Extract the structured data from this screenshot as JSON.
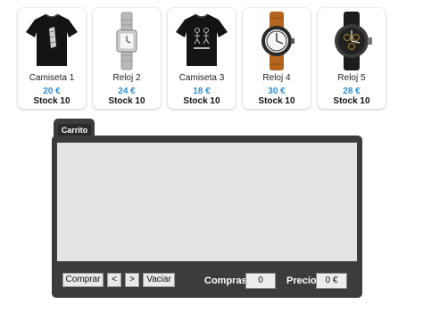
{
  "products": [
    {
      "name": "Camiseta 1",
      "price": "20 €",
      "stock": "Stock 10",
      "icon": "tshirt-icon"
    },
    {
      "name": "Reloj 2",
      "price": "24 €",
      "stock": "Stock 10",
      "icon": "watch-icon"
    },
    {
      "name": "Camiseta 3",
      "price": "18 €",
      "stock": "Stock 10",
      "icon": "tshirt-icon"
    },
    {
      "name": "Reloj 4",
      "price": "30 €",
      "stock": "Stock 10",
      "icon": "watch-icon"
    },
    {
      "name": "Reloj 5",
      "price": "28 €",
      "stock": "Stock 10",
      "icon": "watch-icon"
    }
  ],
  "cart": {
    "tab_label": "Carrito",
    "buttons": {
      "buy": "Comprar",
      "prev": "<",
      "next": ">",
      "empty": "Vaciar"
    },
    "purchases_label": "Compras",
    "purchases_value": "0",
    "price_label": "Precio",
    "price_value": "0 €"
  },
  "colors": {
    "price": "#2b8fd0",
    "panel": "#3c3c3c",
    "cart_area": "#e4e4e4"
  }
}
